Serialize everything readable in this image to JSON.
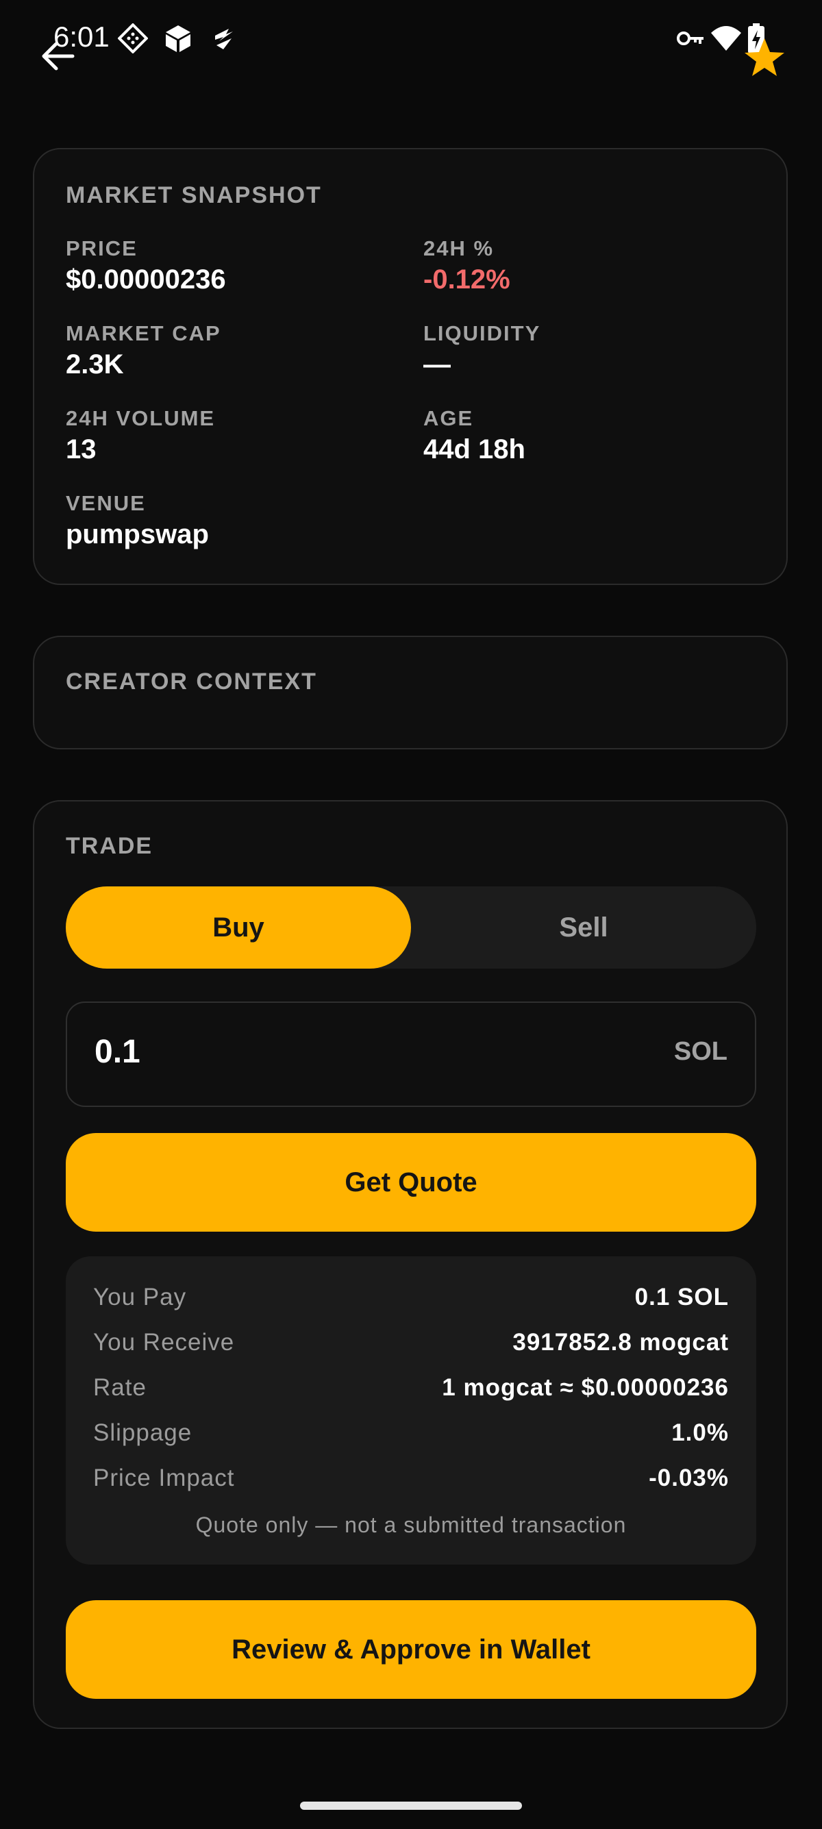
{
  "status_bar": {
    "time": "6:01",
    "left_icons": [
      "diamond-grid-icon",
      "cube-icon",
      "lightning-icon"
    ],
    "right_icons": [
      "key-icon",
      "wifi-icon",
      "battery-charging-icon"
    ]
  },
  "header": {
    "back_icon": "arrow-left-icon",
    "favorite_icon": "star-icon",
    "accent": "#ffb300"
  },
  "market_snapshot": {
    "title": "MARKET SNAPSHOT",
    "stats": [
      {
        "label": "PRICE",
        "value": "$0.00000236"
      },
      {
        "label": "24H %",
        "value": "-0.12%"
      },
      {
        "label": "MARKET CAP",
        "value": "2.3K"
      },
      {
        "label": "LIQUIDITY",
        "value": "—"
      },
      {
        "label": "24H VOLUME",
        "value": "13"
      },
      {
        "label": "AGE",
        "value": "44d 18h"
      },
      {
        "label": "VENUE",
        "value": "pumpswap"
      }
    ],
    "negative_color": "#f26b6b"
  },
  "creator_context": {
    "title": "CREATOR CONTEXT"
  },
  "trade": {
    "title": "TRADE",
    "toggle": {
      "buy": "Buy",
      "sell": "Sell",
      "selected": "Buy"
    },
    "amount": {
      "value": "0.1",
      "unit": "SOL"
    },
    "get_quote_label": "Get Quote",
    "quote": {
      "rows": [
        {
          "label": "You Pay",
          "value": "0.1 SOL"
        },
        {
          "label": "You Receive",
          "value": "3917852.8 mogcat"
        },
        {
          "label": "Rate",
          "value": "1 mogcat ≈ $0.00000236"
        },
        {
          "label": "Slippage",
          "value": "1.0%"
        },
        {
          "label": "Price Impact",
          "value": "-0.03%"
        }
      ],
      "note": "Quote only — not a submitted transaction"
    },
    "approve_label": "Review & Approve in Wallet"
  }
}
